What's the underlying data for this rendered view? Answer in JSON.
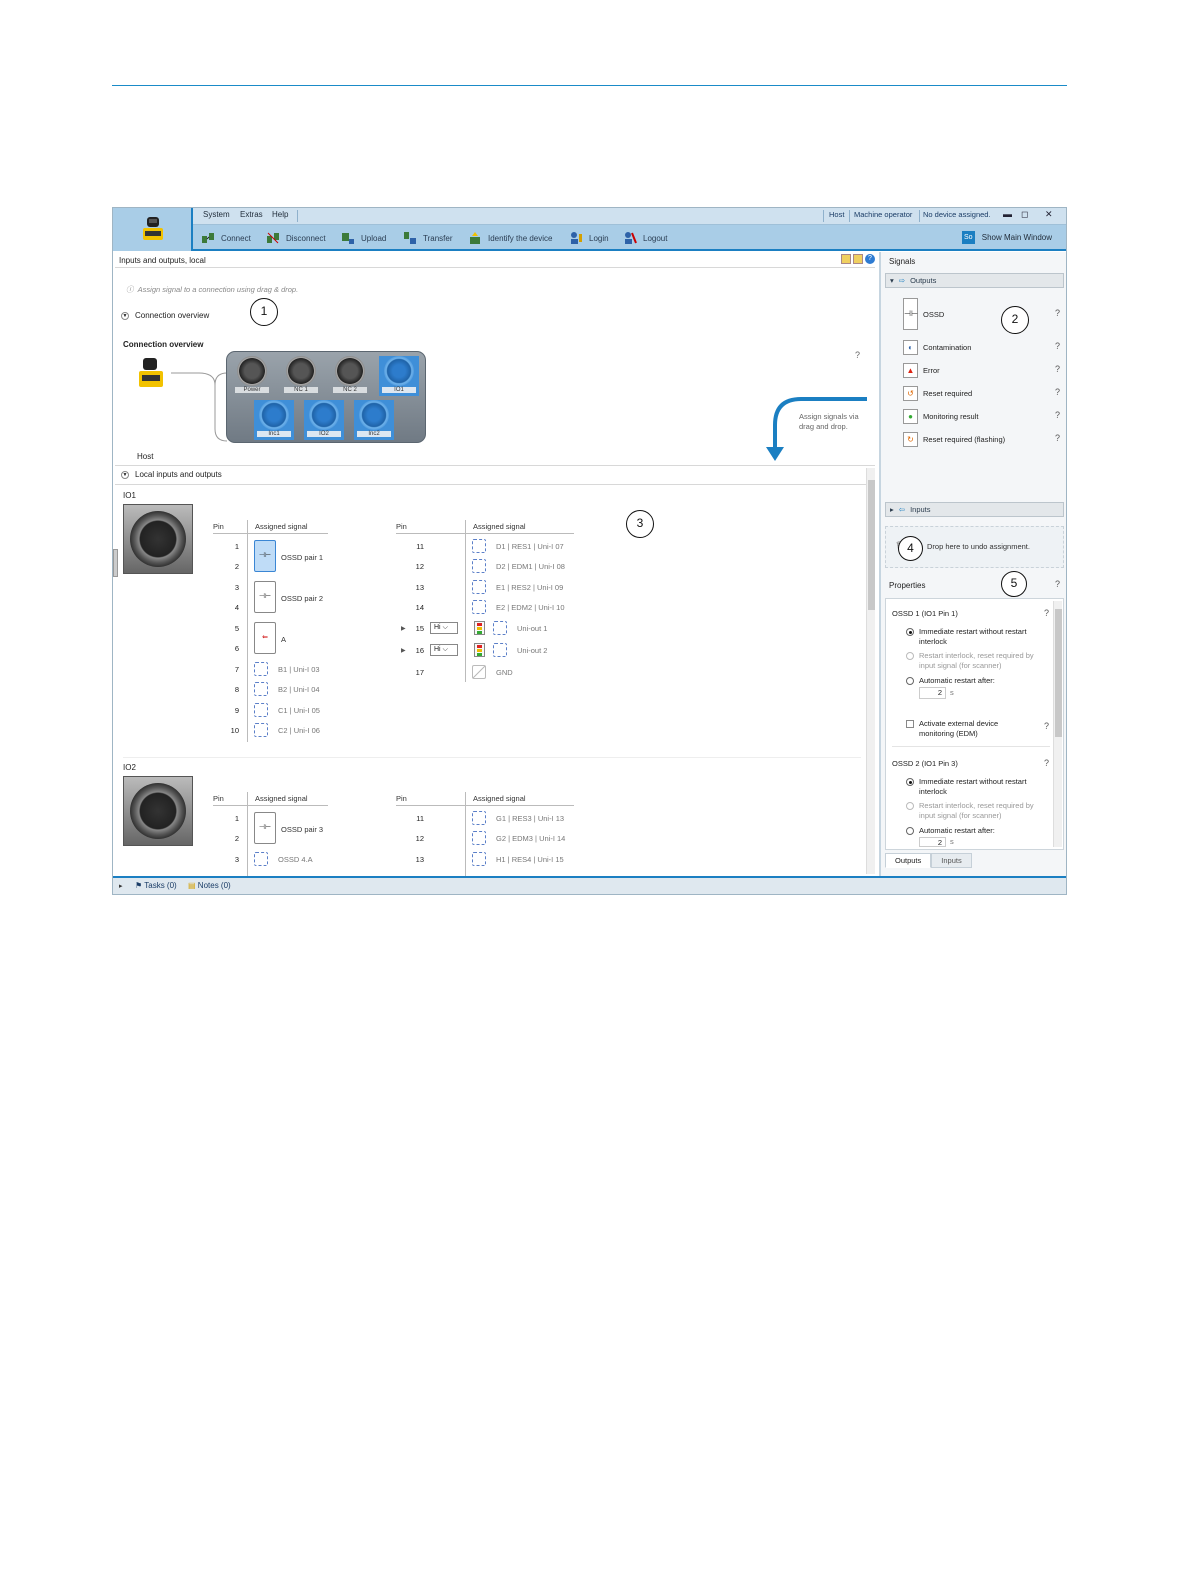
{
  "menu": {
    "system": "System",
    "extras": "Extras",
    "help": "Help"
  },
  "status": {
    "host": "Host",
    "role": "Machine operator",
    "device": "No device assigned."
  },
  "toolbar": {
    "connect": "Connect",
    "disconnect": "Disconnect",
    "upload": "Upload",
    "transfer": "Transfer",
    "identify": "Identify the device",
    "login": "Login",
    "logout": "Logout",
    "show_main_icon": "So",
    "show_main": "Show Main Window"
  },
  "main": {
    "title": "Inputs and outputs, local",
    "hint": "Assign signal to a connection using drag & drop.",
    "connection_overview": "Connection overview",
    "connection_overview_bold": "Connection overview",
    "host": "Host",
    "assign_note_1": "Assign signals via",
    "assign_note_2": "drag and drop.",
    "local_io": "Local inputs and outputs",
    "connectors_top": [
      "Power",
      "NC 1",
      "NC 2",
      "IO1"
    ],
    "connectors_bottom": [
      "Inc1",
      "IO2",
      "Inc2"
    ]
  },
  "io1": {
    "label": "IO1",
    "pin_header": "Pin",
    "signal_header": "Assigned signal",
    "left": [
      {
        "pin": "1",
        "signal": "OSSD pair 1"
      },
      {
        "pin": "2",
        "signal": ""
      },
      {
        "pin": "3",
        "signal": "OSSD pair 2"
      },
      {
        "pin": "4",
        "signal": ""
      },
      {
        "pin": "5",
        "signal": "A"
      },
      {
        "pin": "6",
        "signal": ""
      },
      {
        "pin": "7",
        "signal": "B1 | Uni-I 03"
      },
      {
        "pin": "8",
        "signal": "B2 | Uni-I 04"
      },
      {
        "pin": "9",
        "signal": "C1 | Uni-I 05"
      },
      {
        "pin": "10",
        "signal": "C2 | Uni-I 06"
      }
    ],
    "right": [
      {
        "pin": "11",
        "signal": "D1 | RES1 | Uni-I 07"
      },
      {
        "pin": "12",
        "signal": "D2 | EDM1 | Uni-I 08"
      },
      {
        "pin": "13",
        "signal": "E1 | RES2 | Uni-I 09"
      },
      {
        "pin": "14",
        "signal": "E2 | EDM2 | Uni-I 10"
      },
      {
        "pin": "15",
        "signal": "Uni-out 1",
        "level": "Hi"
      },
      {
        "pin": "16",
        "signal": "Uni-out 2",
        "level": "Hi"
      },
      {
        "pin": "17",
        "signal": "GND"
      }
    ]
  },
  "io2": {
    "label": "IO2",
    "pin_header": "Pin",
    "signal_header": "Assigned signal",
    "left": [
      {
        "pin": "1",
        "signal": "OSSD pair 3"
      },
      {
        "pin": "2",
        "signal": ""
      },
      {
        "pin": "3",
        "signal": "OSSD 4.A"
      }
    ],
    "right": [
      {
        "pin": "11",
        "signal": "G1 | RES3 | Uni-I 13"
      },
      {
        "pin": "12",
        "signal": "G2 | EDM3 | Uni-I 14"
      },
      {
        "pin": "13",
        "signal": "H1 | RES4 | Uni-I 15"
      }
    ]
  },
  "signals": {
    "title": "Signals",
    "outputs": "Outputs",
    "inputs": "Inputs",
    "items": [
      "OSSD",
      "Contamination",
      "Error",
      "Reset required",
      "Monitoring result",
      "Reset required (flashing)"
    ],
    "drop": "Drop here to undo assignment."
  },
  "properties": {
    "title": "Properties",
    "ossd1": "OSSD 1 (IO1 Pin 1)",
    "ossd2": "OSSD 2 (IO1 Pin 3)",
    "opt_immediate": "Immediate restart without restart interlock",
    "opt_interlock": "Restart interlock, reset required by input signal (for scanner)",
    "opt_auto": "Automatic restart after:",
    "auto_value": "2",
    "auto_unit": "s",
    "edm": "Activate external device monitoring (EDM)",
    "tab_outputs": "Outputs",
    "tab_inputs": "Inputs"
  },
  "bottom": {
    "tasks": "Tasks (0)",
    "notes": "Notes (0)"
  },
  "callouts": [
    "1",
    "2",
    "3",
    "4",
    "5"
  ],
  "colors": {
    "accent": "#1b7fc2",
    "toolbar": "#a9cde7",
    "selected_connector": "#3f8fd8"
  }
}
